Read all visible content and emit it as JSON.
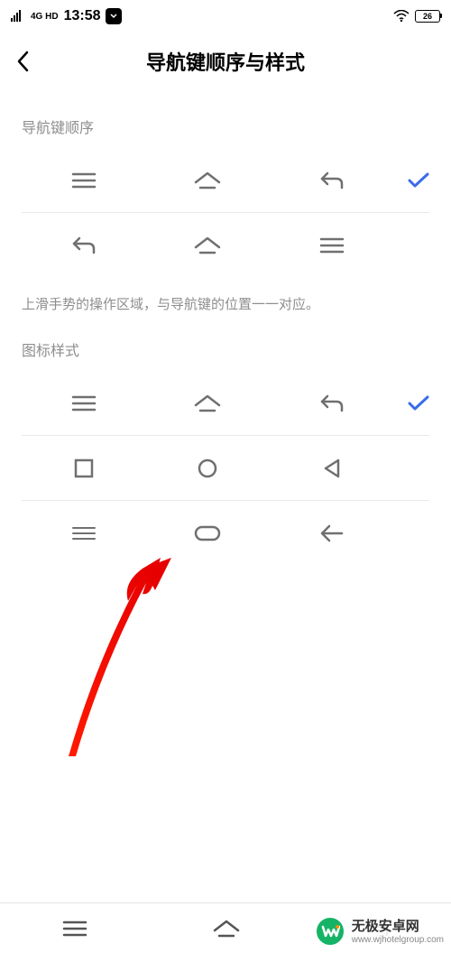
{
  "status": {
    "network": "4G HD",
    "time": "13:58",
    "battery": "26"
  },
  "header": {
    "title": "导航键顺序与样式"
  },
  "order": {
    "label": "导航键顺序",
    "hint": "上滑手势的操作区域，与导航键的位置一一对应。"
  },
  "style": {
    "label": "图标样式"
  },
  "watermark": {
    "brand": "无极安卓网",
    "domain": "www.wjhotelgroup.com"
  }
}
